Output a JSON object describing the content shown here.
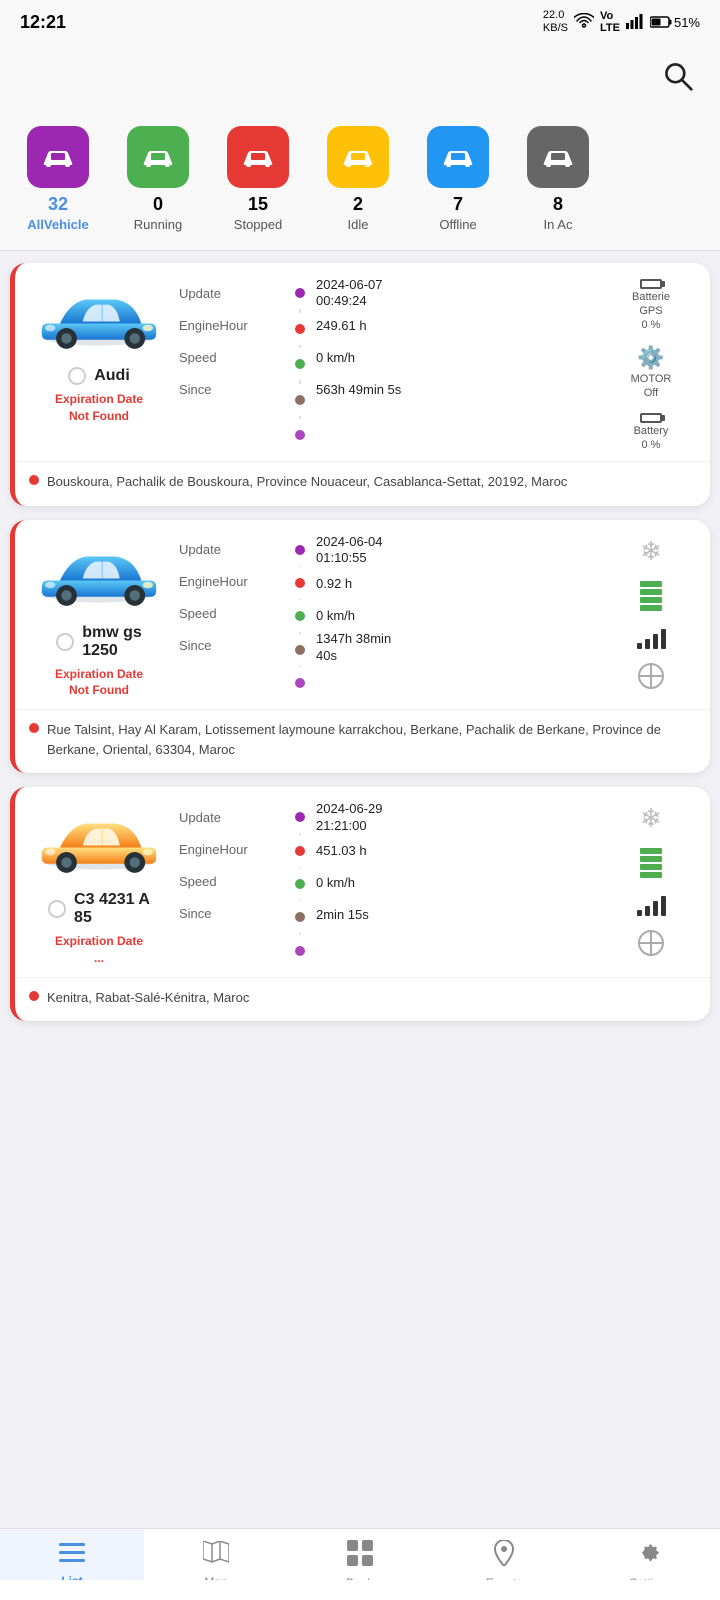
{
  "statusBar": {
    "time": "12:21",
    "network": "22.0 KB/S",
    "battery": "51%"
  },
  "filterTabs": [
    {
      "id": "all",
      "count": "32",
      "label": "AllVehicle",
      "color": "#9c27b0",
      "active": true
    },
    {
      "id": "running",
      "count": "0",
      "label": "Running",
      "color": "#4caf50",
      "active": false
    },
    {
      "id": "stopped",
      "count": "15",
      "label": "Stopped",
      "color": "#e53935",
      "active": false
    },
    {
      "id": "idle",
      "count": "2",
      "label": "Idle",
      "color": "#ffc107",
      "active": false
    },
    {
      "id": "offline",
      "count": "7",
      "label": "Offline",
      "color": "#2196f3",
      "active": false
    },
    {
      "id": "inac",
      "count": "8",
      "label": "In Ac",
      "color": "#555",
      "active": false
    }
  ],
  "vehicles": [
    {
      "name": "Audi",
      "expiryLabel": "Expiration Date\nNot Found",
      "carColor": "blue",
      "update": "2024-06-07\n00:49:24",
      "engineHour": "249.61 h",
      "speed": "0 km/h",
      "since": "563h 49min 5s",
      "batterie": "Batterie",
      "gps": "GPS",
      "gpsValue": "0 %",
      "motorLabel": "MOTOR",
      "motorValue": "Off",
      "batteryLabel": "Battery",
      "batteryValue": "0 %",
      "address": "Bouskoura, Pachalik de Bouskoura, Province Nouaceur, Casablanca-Settat, 20192, Maroc",
      "rightIcons": [
        "battery-gps",
        "motor",
        "battery-pct"
      ]
    },
    {
      "name": "bmw gs\n1250",
      "expiryLabel": "Expiration Date\nNot Found",
      "carColor": "blue",
      "update": "2024-06-04\n01:10:55",
      "engineHour": "0.92 h",
      "speed": "0 km/h",
      "since": "1347h 38min\n40s",
      "address": "Rue Talsint, Hay Al Karam, Lotissement laymoune karrakchou, Berkane, Pachalik de Berkane, Province de Berkane, Oriental, 63304, Maroc",
      "rightIcons": [
        "snowflake",
        "battery-green",
        "signal",
        "crosshair"
      ]
    },
    {
      "name": "C3 4231 A\n85",
      "expiryLabel": "Expiration Date\n...",
      "carColor": "yellow",
      "update": "2024-06-29\n21:21:00",
      "engineHour": "451.03 h",
      "speed": "0 km/h",
      "since": "2min 15s",
      "address": "Kenitra, Rabat-Salé-Kénitra, Maroc",
      "rightIcons": [
        "snowflake",
        "battery-green",
        "signal",
        "crosshair"
      ]
    }
  ],
  "bottomNav": [
    {
      "id": "list",
      "label": "List",
      "active": true
    },
    {
      "id": "map",
      "label": "Map",
      "active": false
    },
    {
      "id": "dash",
      "label": "Dash",
      "active": false
    },
    {
      "id": "events",
      "label": "Events",
      "active": false
    },
    {
      "id": "setting",
      "label": "Setting",
      "active": false
    }
  ]
}
